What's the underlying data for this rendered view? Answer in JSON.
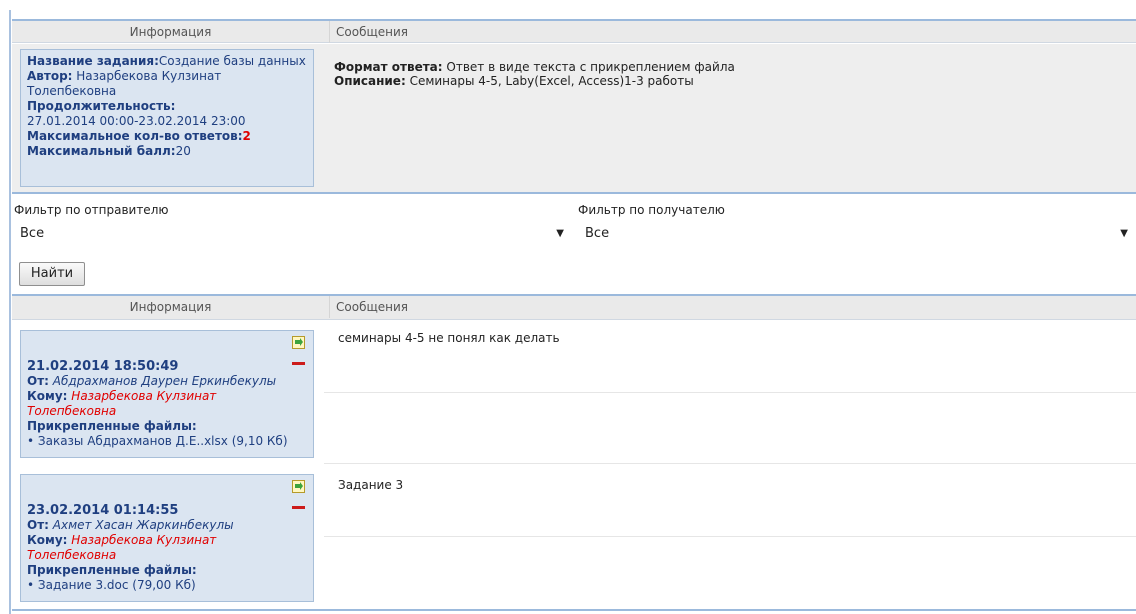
{
  "header_top": {
    "info_label": "Информация",
    "messages_label": "Сообщения"
  },
  "task": {
    "name_label": "Название задания:",
    "name_value": "Создание базы данных",
    "author_label": "Автор:",
    "author_value": " Назарбекова Кулзинат Толепбековна",
    "duration_label": "Продолжительность:",
    "duration_value": "27.01.2014 00:00-23.02.2014 23:00",
    "max_answers_label": "Максимальное кол-во ответов:",
    "max_answers_value": "2",
    "max_score_label": "Максимальный балл:",
    "max_score_value": "20",
    "format_label": "Формат ответа:",
    "format_value": " Ответ в виде текста с прикреплением файла",
    "description_label": "Описание:",
    "description_value": " Семинары 4-5, Laby(Excel, Access)1-3 работы"
  },
  "filters": {
    "sender_label": "Фильтр по отправителю",
    "sender_value": "Все",
    "recipient_label": "Фильтр по получателю",
    "recipient_value": "Все",
    "find_button": "Найти"
  },
  "header_messages": {
    "info_label": "Информация",
    "messages_label": "Сообщения"
  },
  "messages": [
    {
      "datetime": "21.02.2014 18:50:49",
      "from_label": "От:",
      "from": " Абдрахманов Даурен Еркинбекулы",
      "to_label": "Кому:",
      "to": " Назарбекова Кулзинат Толепбековна",
      "files_label": "Прикрепленные файлы:",
      "file": "Заказы Абдрахманов Д.Е..xlsx (9,10 Кб)",
      "text": "семинары 4-5 не понял как делать"
    },
    {
      "datetime": "23.02.2014 01:14:55",
      "from_label": "От:",
      "from": " Ахмет Хасан Жаркинбекулы",
      "to_label": "Кому:",
      "to": " Назарбекова Кулзинат Толепбековна",
      "files_label": "Прикрепленные файлы:",
      "file": "Задание 3.doc (79,00 Кб)",
      "text": "Задание 3"
    }
  ],
  "colors": {
    "accent": "#9bb9dc",
    "info_box": "#dbe5f1",
    "label_blue": "#1f3f80",
    "highlight_red": "#e00000"
  },
  "icons": {
    "reply": "reply-icon",
    "delete": "delete-icon"
  }
}
